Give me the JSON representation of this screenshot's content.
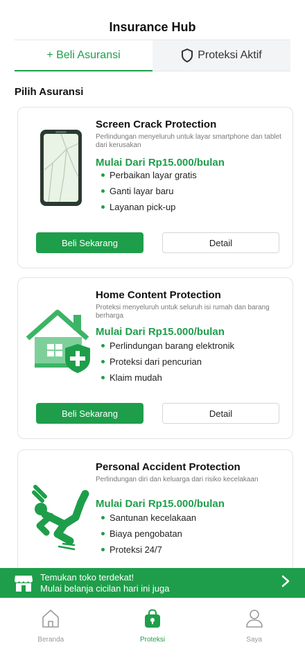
{
  "header": {
    "title": "Insurance Hub"
  },
  "tabs": [
    {
      "label": "+ Beli Asuransi"
    },
    {
      "label": "Proteksi Aktif",
      "icon": "shield-icon"
    }
  ],
  "section_title": "Pilih Asuransi",
  "cards": [
    {
      "name": "Screen Crack Protection",
      "description": "Perlindungan menyeluruh untuk layar smartphone dan tablet dari kerusakan",
      "price": "Mulai Dari Rp15.000/bulan",
      "features": [
        "Perbaikan layar gratis",
        "Ganti layar baru",
        "Layanan pick-up"
      ],
      "buy_label": "Beli Sekarang",
      "detail_label": "Detail",
      "icon": "cracked-phone-icon"
    },
    {
      "name": "Home Content Protection",
      "description": "Proteksi menyeluruh untuk seluruh isi rumah dan barang berharga",
      "price": "Mulai Dari Rp15.000/bulan",
      "features": [
        "Perlindungan barang elektronik",
        "Proteksi dari pencurian",
        "Klaim mudah"
      ],
      "buy_label": "Beli Sekarang",
      "detail_label": "Detail",
      "icon": "house-shield-icon"
    },
    {
      "name": "Personal Accident Protection",
      "description": "Perlindungan diri dan keluarga dari risiko kecelakaan",
      "price": "Mulai Dari Rp15.000/bulan",
      "features": [
        "Santunan kecelakaan",
        "Biaya pengobatan",
        "Proteksi 24/7"
      ],
      "icon": "falling-person-icon"
    }
  ],
  "banner": {
    "line1": "Temukan toko terdekat!",
    "line2": "Mulai belanja cicilan hari ini juga",
    "icon": "store-icon"
  },
  "nav": [
    {
      "label": "Beranda",
      "icon": "home-icon"
    },
    {
      "label": "Proteksi",
      "icon": "lock-bag-icon",
      "active": true
    },
    {
      "label": "Saya",
      "icon": "user-icon"
    }
  ],
  "colors": {
    "accent": "#1e9e4a",
    "illustration_green": "#3cb466",
    "light_green": "#7ed09a"
  }
}
